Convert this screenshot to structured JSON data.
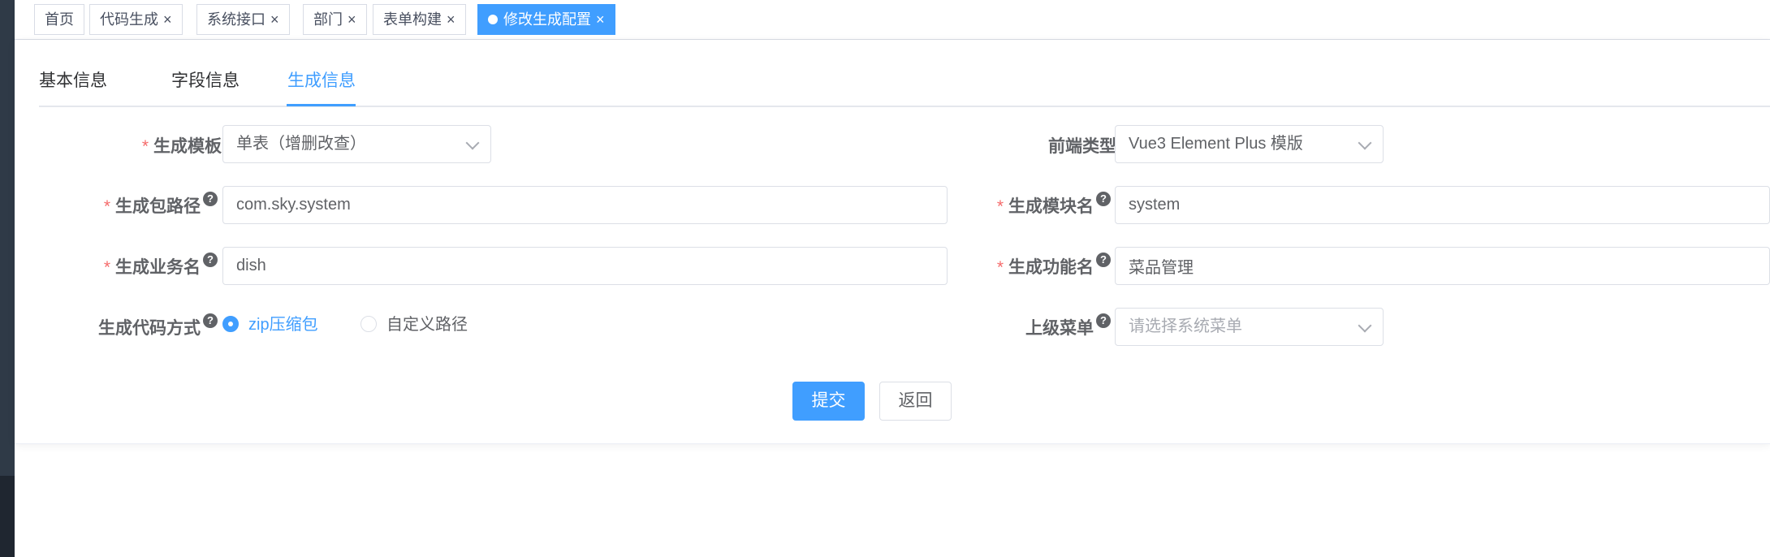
{
  "tags": [
    {
      "label": "首页",
      "closable": false
    },
    {
      "label": "代码生成",
      "closable": true
    },
    {
      "label": "系统接口",
      "closable": true
    },
    {
      "label": "部门",
      "closable": true
    },
    {
      "label": "表单构建",
      "closable": true
    },
    {
      "label": "修改生成配置",
      "closable": true,
      "active": true
    }
  ],
  "tabs": {
    "basic": "基本信息",
    "fields": "字段信息",
    "gen": "生成信息"
  },
  "form": {
    "tpl_category": {
      "label": "生成模板",
      "value": "单表（增删改查）"
    },
    "frontend_type": {
      "label": "前端类型",
      "value": "Vue3 Element Plus 模版"
    },
    "package_name": {
      "label": "生成包路径",
      "value": "com.sky.system"
    },
    "module_name": {
      "label": "生成模块名",
      "value": "system"
    },
    "business_name": {
      "label": "生成业务名",
      "value": "dish"
    },
    "function_name": {
      "label": "生成功能名",
      "value": "菜品管理"
    },
    "gen_type": {
      "label": "生成代码方式",
      "option_zip": "zip压缩包",
      "option_custom": "自定义路径",
      "selected": "zip压缩包"
    },
    "parent_menu": {
      "label": "上级菜单",
      "placeholder": "请选择系统菜单"
    }
  },
  "buttons": {
    "submit": "提交",
    "back": "返回"
  },
  "help_glyph": "?",
  "required_mark": "*",
  "close_glyph": "×",
  "colors": {
    "primary": "#409eff",
    "required": "#f56c6c"
  }
}
